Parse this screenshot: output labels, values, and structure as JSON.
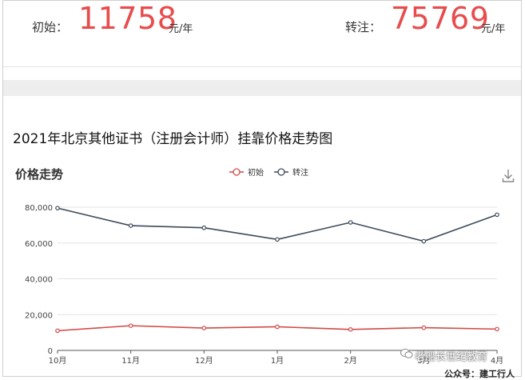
{
  "prices": {
    "initial_label": "初始：",
    "initial_value": "11758",
    "initial_unit": "元/年",
    "transfer_label": "转注：",
    "transfer_value": "75769",
    "transfer_unit": "元/年"
  },
  "page_title": "2021年北京其他证书（注册会计师）挂靠价格走势图",
  "watermark": {
    "line1": "老船长世纪教育",
    "line2": "公众号：建工行人"
  },
  "colors": {
    "initial": "#d2494a",
    "transfer": "#3d4a5a",
    "price_red": "#e84c4c"
  },
  "chart_data": {
    "type": "line",
    "title": "价格走势",
    "categories": [
      "10月",
      "11月",
      "12月",
      "1月",
      "2月",
      "3月",
      "4月"
    ],
    "series": [
      {
        "name": "初始",
        "values": [
          11000,
          13800,
          12500,
          13200,
          11700,
          12700,
          11900
        ]
      },
      {
        "name": "转注",
        "values": [
          79500,
          69700,
          68500,
          62000,
          71500,
          61000,
          75800
        ]
      }
    ],
    "yticks": [
      "0",
      "20,000",
      "40,000",
      "60,000",
      "80,000"
    ],
    "ylim": [
      0,
      80000
    ],
    "grid": true,
    "legend_position": "top-center"
  }
}
